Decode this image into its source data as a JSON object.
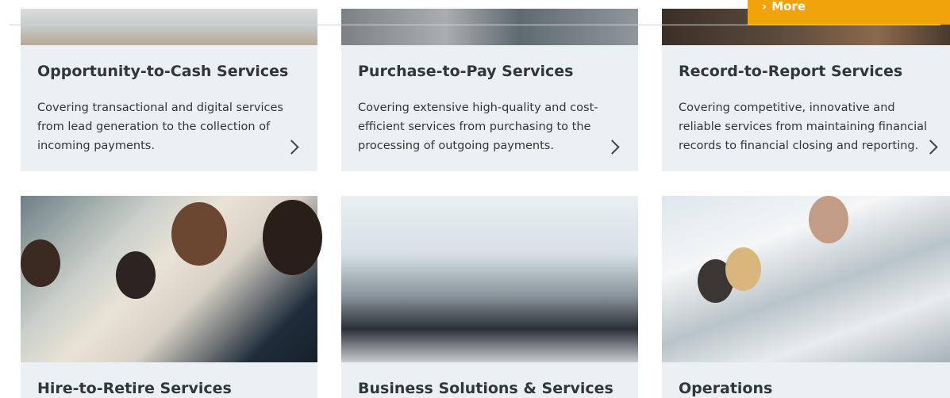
{
  "more_button": {
    "arrow": "›",
    "label": "More"
  },
  "cards": [
    {
      "title": "Opportunity-to-Cash Services",
      "description": "Covering transactional and digital services from lead generation to the collection of incoming payments."
    },
    {
      "title": "Purchase-to-Pay Services",
      "description": "Covering extensive high-quality and cost-efficient services from purchasing to the processing of outgoing payments."
    },
    {
      "title": "Record-to-Report Services",
      "description": "Covering competitive, innovative and reliable services from maintaining financial records to financial closing and reporting."
    },
    {
      "title": "Hire-to-Retire Services"
    },
    {
      "title": "Business Solutions & Services"
    },
    {
      "title": "Operations"
    }
  ]
}
